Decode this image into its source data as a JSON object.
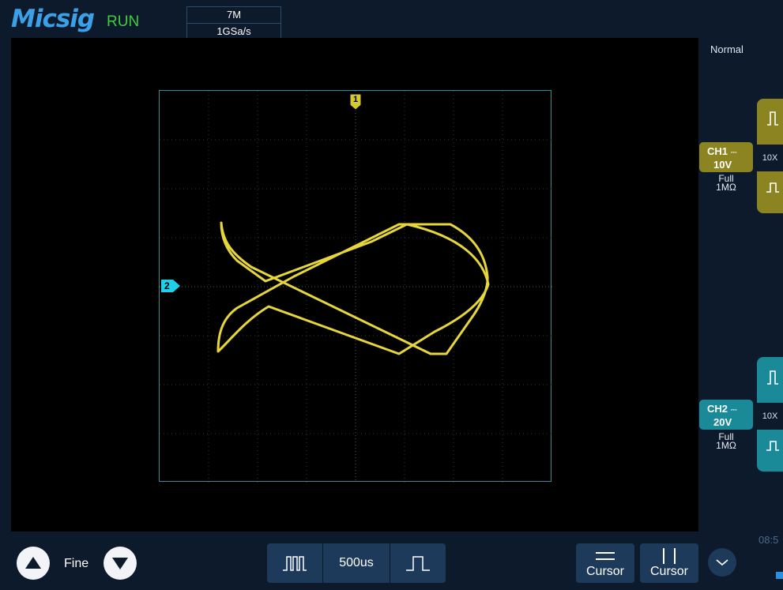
{
  "header": {
    "brand": "Micsig",
    "run_state": "RUN",
    "memory_depth": "7M",
    "sample_rate": "1GSa/s"
  },
  "trigger_mode": "Normal",
  "markers": {
    "ch1": "1",
    "ch2": "2"
  },
  "channels": [
    {
      "name": "CH1",
      "scale": "10V",
      "bandwidth": "Full",
      "impedance": "1MΩ",
      "probe": "10X",
      "color": "#8b8420"
    },
    {
      "name": "CH2",
      "scale": "20V",
      "bandwidth": "Full",
      "impedance": "1MΩ",
      "probe": "10X",
      "color": "#1a8a99"
    }
  ],
  "trace_color": "#e6d63a",
  "bottom": {
    "fine_label": "Fine",
    "timebase": "500us",
    "cursor_h_label": "Cursor",
    "cursor_v_label": "Cursor"
  },
  "status": {
    "time": "08:5"
  }
}
